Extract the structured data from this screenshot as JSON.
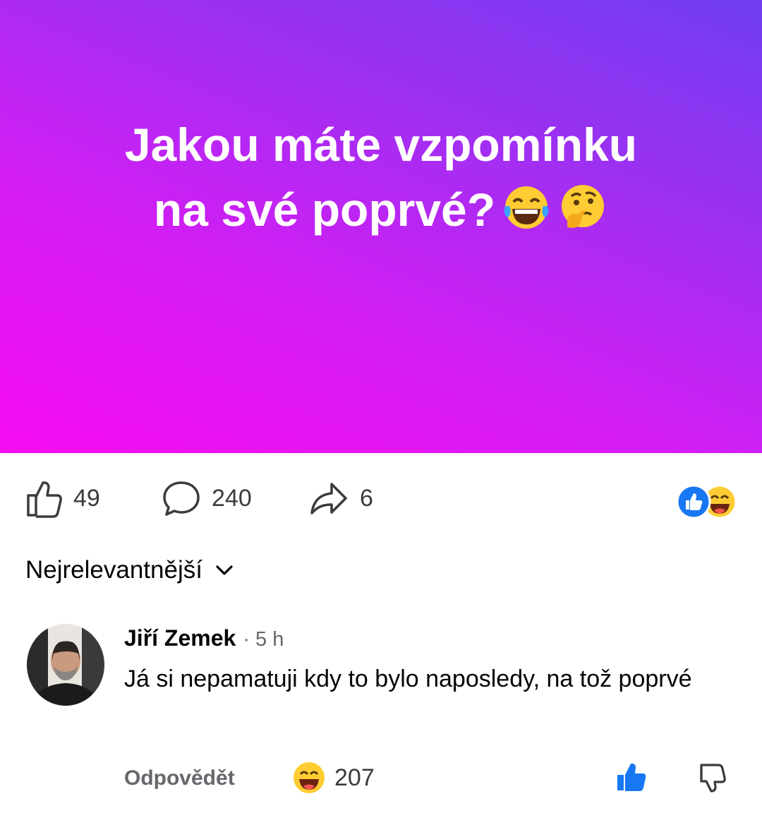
{
  "post": {
    "question_line1": "Jakou máte vzpomínku",
    "question_line2": "na své poprvé?",
    "emojis": [
      "face-with-tears-of-joy-icon",
      "thinking-face-icon"
    ],
    "gradient_colors": [
      "#f70cf2",
      "#6f3df0"
    ]
  },
  "stats": {
    "likes": "49",
    "comments": "240",
    "shares": "6"
  },
  "sort": {
    "label": "Nejrelevantnější"
  },
  "comment": {
    "author": "Jiří Zemek",
    "time": "· 5 h",
    "text": "Já si nepamatuji kdy to bylo naposledy, na tož poprvé",
    "reply_label": "Odpovědět",
    "reaction_count": "207"
  },
  "colors": {
    "like_blue": "#1877f2",
    "text_gray": "#65676b"
  }
}
